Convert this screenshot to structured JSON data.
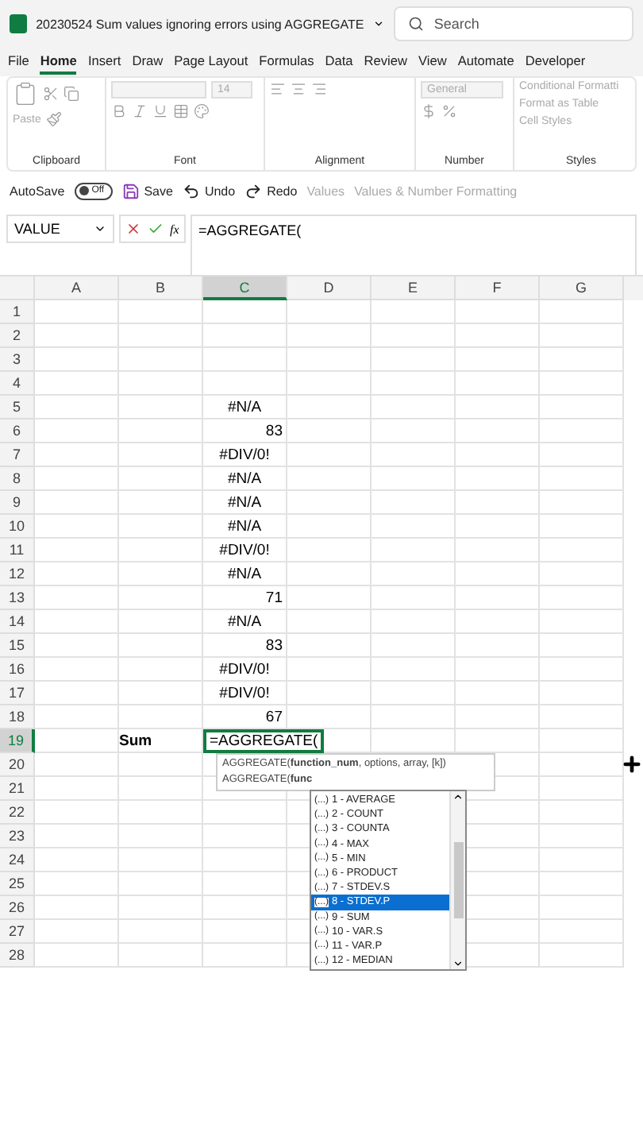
{
  "window": {
    "title": "20230524 Sum values ignoring errors using AGGREGATE",
    "search_placeholder": "Search"
  },
  "ribbon_tabs": [
    {
      "label": "File",
      "selected": false
    },
    {
      "label": "Home",
      "selected": true
    },
    {
      "label": "Insert",
      "selected": false
    },
    {
      "label": "Draw",
      "selected": false
    },
    {
      "label": "Page Layout",
      "selected": false
    },
    {
      "label": "Formulas",
      "selected": false
    },
    {
      "label": "Data",
      "selected": false
    },
    {
      "label": "Review",
      "selected": false
    },
    {
      "label": "View",
      "selected": false
    },
    {
      "label": "Automate",
      "selected": false
    },
    {
      "label": "Developer",
      "selected": false
    }
  ],
  "ribbon": {
    "paste": "Paste",
    "font_size": "14",
    "number_format": "General",
    "styles": [
      "Conditional Formatti",
      "Format as Table",
      "Cell Styles"
    ],
    "groups": [
      "Clipboard",
      "Font",
      "Alignment",
      "Number",
      "Styles"
    ]
  },
  "quick_access": {
    "autosave": "AutoSave",
    "autosave_on": false,
    "autosave_state": "Off",
    "save": "Save",
    "undo": "Undo",
    "redo": "Redo",
    "values": "Values",
    "values_formatting": "Values & Number Formatting"
  },
  "formula_bar": {
    "name_box": "VALUE",
    "fx": "fx",
    "formula": "=AGGREGATE("
  },
  "sheet": {
    "columns": [
      {
        "label": "A",
        "selected": false
      },
      {
        "label": "B",
        "selected": false
      },
      {
        "label": "C",
        "selected": true
      },
      {
        "label": "D",
        "selected": false
      },
      {
        "label": "E",
        "selected": false
      },
      {
        "label": "F",
        "selected": false
      },
      {
        "label": "G",
        "selected": false
      }
    ],
    "rows": [
      {
        "number": "1",
        "cells": {}
      },
      {
        "number": "2",
        "cells": {}
      },
      {
        "number": "3",
        "cells": {}
      },
      {
        "number": "4",
        "cells": {}
      },
      {
        "number": "5",
        "cells": {
          "C": {
            "text": "#N/A",
            "kind": "error"
          }
        }
      },
      {
        "number": "6",
        "cells": {
          "C": {
            "text": "83",
            "kind": "number"
          }
        }
      },
      {
        "number": "7",
        "cells": {
          "C": {
            "text": "#DIV/0!",
            "kind": "error"
          }
        }
      },
      {
        "number": "8",
        "cells": {
          "C": {
            "text": "#N/A",
            "kind": "error"
          }
        }
      },
      {
        "number": "9",
        "cells": {
          "C": {
            "text": "#N/A",
            "kind": "error"
          }
        }
      },
      {
        "number": "10",
        "cells": {
          "C": {
            "text": "#N/A",
            "kind": "error"
          }
        }
      },
      {
        "number": "11",
        "cells": {
          "C": {
            "text": "#DIV/0!",
            "kind": "error"
          }
        }
      },
      {
        "number": "12",
        "cells": {
          "C": {
            "text": "#N/A",
            "kind": "error"
          }
        }
      },
      {
        "number": "13",
        "cells": {
          "C": {
            "text": "71",
            "kind": "number"
          }
        }
      },
      {
        "number": "14",
        "cells": {
          "C": {
            "text": "#N/A",
            "kind": "error"
          }
        }
      },
      {
        "number": "15",
        "cells": {
          "C": {
            "text": "83",
            "kind": "number"
          }
        }
      },
      {
        "number": "16",
        "cells": {
          "C": {
            "text": "#DIV/0!",
            "kind": "error"
          }
        }
      },
      {
        "number": "17",
        "cells": {
          "C": {
            "text": "#DIV/0!",
            "kind": "error"
          }
        }
      },
      {
        "number": "18",
        "cells": {
          "C": {
            "text": "67",
            "kind": "number"
          }
        }
      },
      {
        "number": "19",
        "selected": true,
        "cells": {
          "B": {
            "text": "Sum",
            "kind": "label"
          },
          "C": {
            "text": "=AGGREGATE(",
            "kind": "editing"
          }
        }
      },
      {
        "number": "20",
        "cells": {}
      },
      {
        "number": "21",
        "cells": {}
      },
      {
        "number": "22",
        "cells": {}
      },
      {
        "number": "23",
        "cells": {}
      },
      {
        "number": "24",
        "cells": {}
      },
      {
        "number": "25",
        "cells": {}
      },
      {
        "number": "26",
        "cells": {}
      },
      {
        "number": "27",
        "cells": {}
      },
      {
        "number": "28",
        "cells": {}
      }
    ]
  },
  "tooltip": {
    "lines": [
      "AGGREGATE(**function_num**, options, array, [k])",
      "AGGREGATE(**func**"
    ]
  },
  "function_list": [
    {
      "icon": "(...)",
      "label": "1 - AVERAGE",
      "selected": false
    },
    {
      "icon": "(...)",
      "label": "2 - COUNT",
      "selected": false
    },
    {
      "icon": "(...)",
      "label": "3 - COUNTA",
      "selected": false
    },
    {
      "icon": "(...)",
      "label": "4 - MAX",
      "selected": false
    },
    {
      "icon": "(...)",
      "label": "5 - MIN",
      "selected": false
    },
    {
      "icon": "(...)",
      "label": "6 - PRODUCT",
      "selected": false
    },
    {
      "icon": "(...)",
      "label": "7 - STDEV.S",
      "selected": false
    },
    {
      "icon": "(...)",
      "label": "8 - STDEV.P",
      "selected": true
    },
    {
      "icon": "(...)",
      "label": "9 - SUM",
      "selected": false
    },
    {
      "icon": "(...)",
      "label": "10 - VAR.S",
      "selected": false
    },
    {
      "icon": "(...)",
      "label": "11 - VAR.P",
      "selected": false
    },
    {
      "icon": "(...)",
      "label": "12 - MEDIAN",
      "selected": false
    }
  ]
}
